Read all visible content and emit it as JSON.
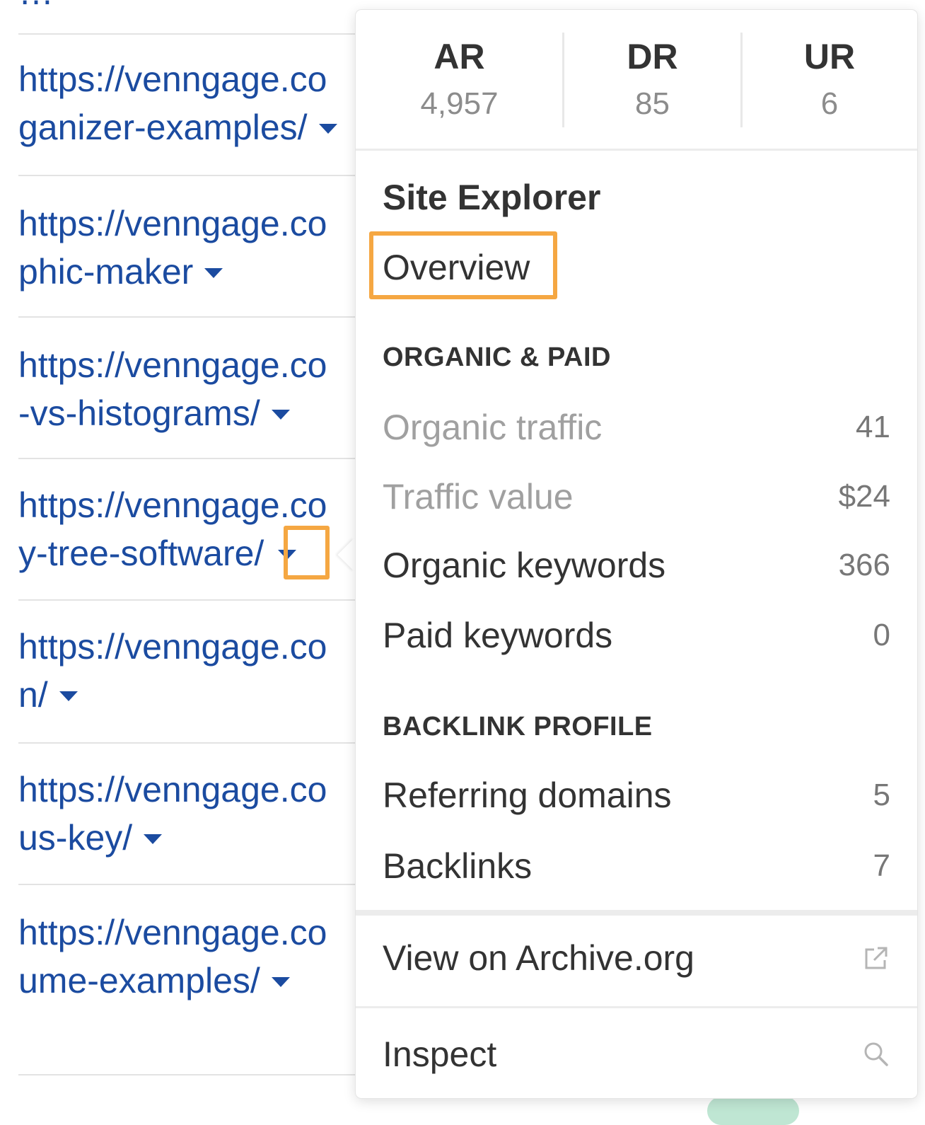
{
  "background_list": {
    "top_partial_text": "…",
    "rows": [
      {
        "line1": "https://venngage.co",
        "line2": "ganizer-examples/"
      },
      {
        "line1": "https://venngage.co",
        "line2": "phic-maker"
      },
      {
        "line1": "https://venngage.co",
        "line2": "-vs-histograms/"
      },
      {
        "line1": "https://venngage.co",
        "line2": "y-tree-software/"
      },
      {
        "line1": "https://venngage.co",
        "line2": "n/"
      },
      {
        "line1": "https://venngage.co",
        "line2": "us-key/"
      },
      {
        "line1": "https://venngage.co",
        "line2": "ume-examples/"
      }
    ]
  },
  "popover": {
    "metrics": [
      {
        "label": "AR",
        "value": "4,957"
      },
      {
        "label": "DR",
        "value": "85"
      },
      {
        "label": "UR",
        "value": "6"
      }
    ],
    "site_explorer_title": "Site Explorer",
    "overview_label": "Overview",
    "organic_paid": {
      "title": "ORGANIC & PAID",
      "items": [
        {
          "label": "Organic traffic",
          "value": "41"
        },
        {
          "label": "Traffic value",
          "value": "$24"
        },
        {
          "label": "Organic keywords",
          "value": "366"
        },
        {
          "label": "Paid keywords",
          "value": "0"
        }
      ]
    },
    "backlink_profile": {
      "title": "BACKLINK PROFILE",
      "items": [
        {
          "label": "Referring domains",
          "value": "5"
        },
        {
          "label": "Backlinks",
          "value": "7"
        }
      ]
    },
    "archive_label": "View on Archive.org",
    "inspect_label": "Inspect"
  },
  "colors": {
    "link": "#1b4ba0",
    "highlight": "#f5a742",
    "muted_text": "#a0a0a0"
  },
  "icons": {
    "dropdown": "caret-down-icon",
    "archive": "external-link-icon",
    "inspect": "search-icon"
  }
}
